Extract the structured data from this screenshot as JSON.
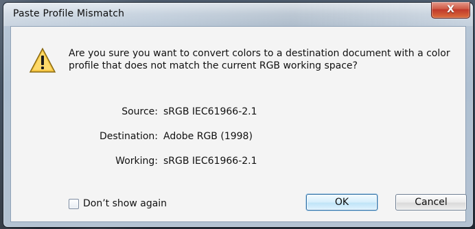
{
  "window": {
    "title": "Paste Profile Mismatch",
    "close_label": "X"
  },
  "dialog": {
    "message": "Are you sure you want to convert colors to a destination document with a color profile that does not match the current RGB working space?",
    "fields": [
      {
        "label": "Source:",
        "value": "sRGB IEC61966-2.1"
      },
      {
        "label": "Destination:",
        "value": "Adobe RGB (1998)"
      },
      {
        "label": "Working:",
        "value": "sRGB IEC61966-2.1"
      }
    ],
    "checkbox": {
      "label": "Don’t show again",
      "checked": false
    },
    "buttons": {
      "ok": "OK",
      "cancel": "Cancel"
    }
  },
  "icons": {
    "warning": "warning-icon",
    "close": "close-icon"
  },
  "colors": {
    "warning_fill": "#f5c542",
    "close_button": "#c0392b",
    "default_button_border": "#2f6fa4"
  }
}
